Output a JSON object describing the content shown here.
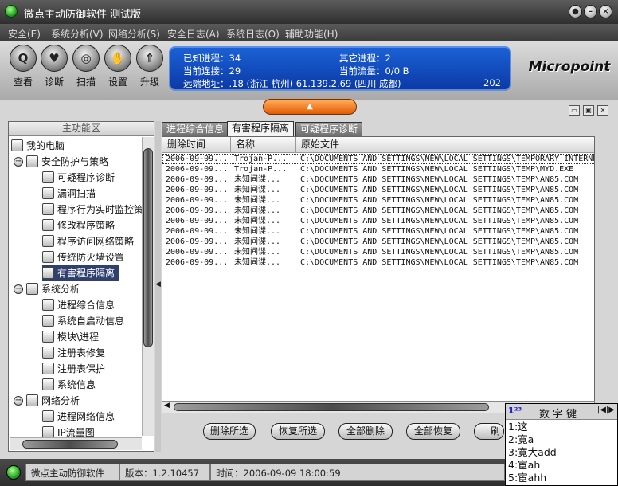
{
  "window": {
    "title": "微点主动防御软件  测试版",
    "buttons": [
      "●",
      "–",
      "×"
    ]
  },
  "menu": [
    "安全(E)",
    "系统分析(V)",
    "网络分析(S)",
    "安全日志(A)",
    "系统日志(O)",
    "辅助功能(H)"
  ],
  "toolbar": [
    {
      "label": "查看",
      "icon": "magnifier-icon",
      "glyph": "Q"
    },
    {
      "label": "诊断",
      "icon": "heart-icon",
      "glyph": "♥"
    },
    {
      "label": "扫描",
      "icon": "scan-icon",
      "glyph": "◎"
    },
    {
      "label": "设置",
      "icon": "hand-icon",
      "glyph": "✋"
    },
    {
      "label": "升级",
      "icon": "upgrade-icon",
      "glyph": "⇑"
    }
  ],
  "status_panel": {
    "known_processes": "已知进程：34",
    "other_processes": "其它进程：2",
    "current_connections": "当前连接：29",
    "current_traffic": "当前流量：0/0 B",
    "remote_address": "远端地址：.18 (浙江 杭州)   61.139.2.69 (四川 成都)",
    "remote_more": "202"
  },
  "logo": "Micropoint",
  "left_panel": {
    "header": "主功能区",
    "tree": [
      {
        "label": "我的电脑",
        "level": 0,
        "icon": "computer-icon"
      },
      {
        "label": "安全防护与策略",
        "level": 1,
        "icon": "shield-icon",
        "toggle": "−"
      },
      {
        "label": "可疑程序诊断",
        "level": 2,
        "icon": "diagnose-icon"
      },
      {
        "label": "漏洞扫描",
        "level": 2,
        "icon": "magnifier-icon"
      },
      {
        "label": "程序行为实时监控策",
        "level": 2,
        "icon": "monitor-icon"
      },
      {
        "label": "修改程序策略",
        "level": 2,
        "icon": "edit-icon"
      },
      {
        "label": "程序访问网络策略",
        "level": 2,
        "icon": "network-icon"
      },
      {
        "label": "传统防火墙设置",
        "level": 2,
        "icon": "firewall-icon"
      },
      {
        "label": "有害程序隔离",
        "level": 2,
        "icon": "quarantine-icon",
        "selected": true
      },
      {
        "label": "系统分析",
        "level": 1,
        "icon": "system-icon",
        "toggle": "−"
      },
      {
        "label": "进程综合信息",
        "level": 2,
        "icon": "process-icon"
      },
      {
        "label": "系统自启动信息",
        "level": 2,
        "icon": "startup-icon"
      },
      {
        "label": "模块\\进程",
        "level": 2,
        "icon": "module-icon"
      },
      {
        "label": "注册表修复",
        "level": 2,
        "icon": "registry-icon"
      },
      {
        "label": "注册表保护",
        "level": 2,
        "icon": "registry-protect-icon"
      },
      {
        "label": "系统信息",
        "level": 2,
        "icon": "info-icon"
      },
      {
        "label": "网络分析",
        "level": 1,
        "icon": "net-icon",
        "toggle": "−"
      },
      {
        "label": "进程网络信息",
        "level": 2,
        "icon": "process-net-icon"
      },
      {
        "label": "IP流量图",
        "level": 2,
        "icon": "chart-icon"
      }
    ]
  },
  "tabs": [
    {
      "label": "进程综合信息",
      "active": false
    },
    {
      "label": "有害程序隔离",
      "active": true
    },
    {
      "label": "可疑程序诊断",
      "active": false
    }
  ],
  "table": {
    "columns": [
      "删除时间",
      "名称",
      "原始文件"
    ],
    "rows": [
      [
        "2006-09-09...",
        "Trojan-P...",
        "C:\\DOCUMENTS AND SETTINGS\\NEW\\LOCAL SETTINGS\\TEMPORARY INTERNE"
      ],
      [
        "2006-09-09...",
        "Trojan-P...",
        "C:\\DOCUMENTS AND SETTINGS\\NEW\\LOCAL SETTINGS\\TEMP\\MYD.EXE"
      ],
      [
        "2006-09-09...",
        "未知间谍...",
        "C:\\DOCUMENTS AND SETTINGS\\NEW\\LOCAL SETTINGS\\TEMP\\AN85.COM"
      ],
      [
        "2006-09-09...",
        "未知间谍...",
        "C:\\DOCUMENTS AND SETTINGS\\NEW\\LOCAL SETTINGS\\TEMP\\AN85.COM"
      ],
      [
        "2006-09-09...",
        "未知间谍...",
        "C:\\DOCUMENTS AND SETTINGS\\NEW\\LOCAL SETTINGS\\TEMP\\AN85.COM"
      ],
      [
        "2006-09-09...",
        "未知间谍...",
        "C:\\DOCUMENTS AND SETTINGS\\NEW\\LOCAL SETTINGS\\TEMP\\AN85.COM"
      ],
      [
        "2006-09-09...",
        "未知间谍...",
        "C:\\DOCUMENTS AND SETTINGS\\NEW\\LOCAL SETTINGS\\TEMP\\AN85.COM"
      ],
      [
        "2006-09-09...",
        "未知间谍...",
        "C:\\DOCUMENTS AND SETTINGS\\NEW\\LOCAL SETTINGS\\TEMP\\AN85.COM"
      ],
      [
        "2006-09-09...",
        "未知间谍...",
        "C:\\DOCUMENTS AND SETTINGS\\NEW\\LOCAL SETTINGS\\TEMP\\AN85.COM"
      ],
      [
        "2006-09-09...",
        "未知间谍...",
        "C:\\DOCUMENTS AND SETTINGS\\NEW\\LOCAL SETTINGS\\TEMP\\AN85.COM"
      ],
      [
        "2006-09-09...",
        "未知间谍...",
        "C:\\DOCUMENTS AND SETTINGS\\NEW\\LOCAL SETTINGS\\TEMP\\AN85.COM"
      ]
    ]
  },
  "actions": [
    "删除所选",
    "恢复所选",
    "全部删除",
    "全部恢复",
    "刷"
  ],
  "statusbar": {
    "app": "微点主动防御软件",
    "version": "版本：1.2.10457",
    "time": "时间：2006-09-09 18:00:59"
  },
  "ime": {
    "icon_text": "1²³",
    "title": "数字键",
    "nav": "|◀|▶",
    "candidates": [
      "1:这",
      "2:寛a",
      "3:寛大add",
      "4:宦ah",
      "5:宦ahh"
    ]
  }
}
